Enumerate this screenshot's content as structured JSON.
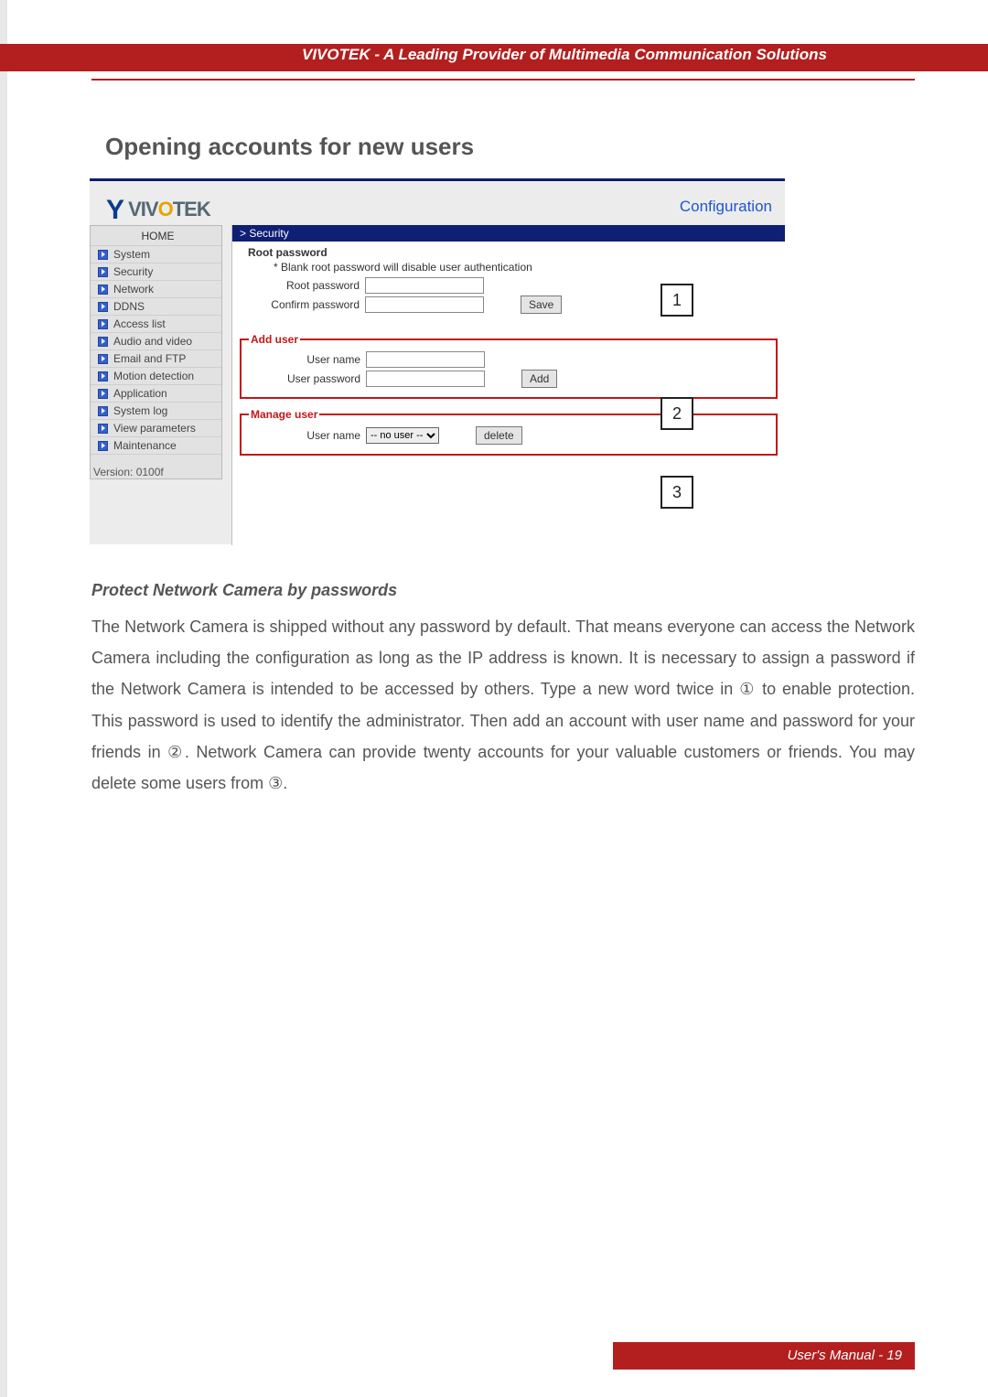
{
  "header": {
    "tagline": "VIVOTEK - A Leading Provider of Multimedia Communication Solutions"
  },
  "page": {
    "heading": "Opening accounts for new users",
    "subheading": "Protect Network Camera by passwords",
    "body": "The Network Camera is shipped without any password by default. That means everyone can access the Network Camera including the configuration as long as the IP address is known. It is necessary to assign a password if the Network Camera is intended to be accessed by others. Type a new word twice in ① to enable protection. This password is used to identify the administrator. Then add an account with user name and password for your friends in ②. Network Camera can provide twenty accounts for your valuable customers or friends. You may delete some users from ③."
  },
  "footer": {
    "label": "User's Manual - 19"
  },
  "ui": {
    "logo": {
      "text": "VIVOTEK"
    },
    "config_link": "Configuration",
    "breadcrumb": "> Security",
    "nav": {
      "home": "HOME",
      "items": [
        "System",
        "Security",
        "Network",
        "DDNS",
        "Access list",
        "Audio and video",
        "Email and FTP",
        "Motion detection",
        "Application",
        "System log",
        "View parameters",
        "Maintenance"
      ],
      "version": "Version: 0100f"
    },
    "root_pw": {
      "title": "Root password",
      "warning": "* Blank root password will disable user authentication",
      "root_label": "Root password",
      "confirm_label": "Confirm password",
      "save_btn": "Save"
    },
    "add_user": {
      "legend": "Add user",
      "name_label": "User name",
      "pw_label": "User password",
      "add_btn": "Add"
    },
    "manage_user": {
      "legend": "Manage user",
      "name_label": "User name",
      "selected": "-- no user --",
      "delete_btn": "delete"
    },
    "callouts": {
      "c1": "1",
      "c2": "2",
      "c3": "3"
    }
  }
}
